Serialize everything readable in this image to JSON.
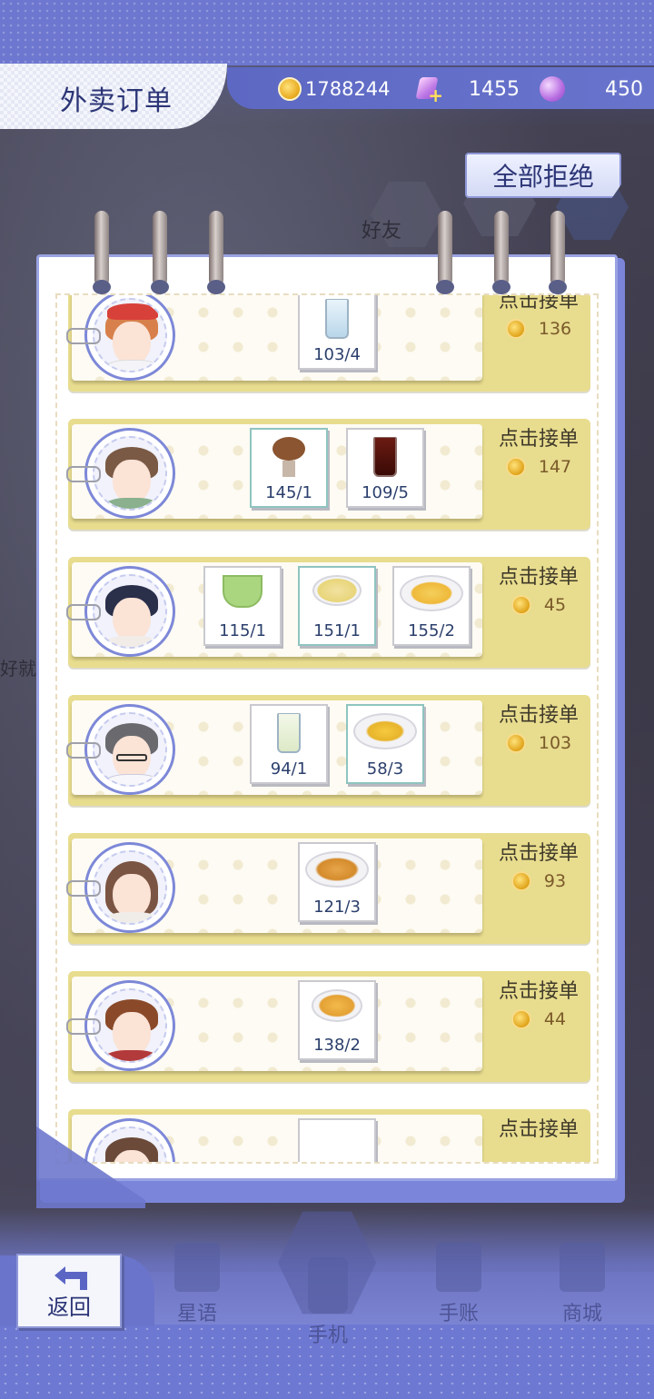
{
  "header": {
    "title": "外卖订单",
    "gold": "1788244",
    "diamonds": "1455",
    "stars": "450",
    "reject_all_label": "全部拒绝"
  },
  "background": {
    "friends_label": "好友",
    "left_text": "好就"
  },
  "orders": [
    {
      "accept_label": "点击接单",
      "reward": "136",
      "items": [
        {
          "name": "ice water",
          "count": "103/4"
        }
      ]
    },
    {
      "accept_label": "点击接单",
      "reward": "147",
      "items": [
        {
          "name": "chocolate sundae",
          "count": "145/1"
        },
        {
          "name": "cola",
          "count": "109/5"
        }
      ]
    },
    {
      "accept_label": "点击接单",
      "reward": "45",
      "items": [
        {
          "name": "green tea",
          "count": "115/1"
        },
        {
          "name": "corn soup",
          "count": "151/1"
        },
        {
          "name": "fruit plate",
          "count": "155/2"
        }
      ]
    },
    {
      "accept_label": "点击接单",
      "reward": "103",
      "items": [
        {
          "name": "milk",
          "count": "94/1"
        },
        {
          "name": "cake",
          "count": "58/3"
        }
      ]
    },
    {
      "accept_label": "点击接单",
      "reward": "93",
      "items": [
        {
          "name": "fried fish",
          "count": "121/3"
        }
      ]
    },
    {
      "accept_label": "点击接单",
      "reward": "44",
      "items": [
        {
          "name": "pancakes",
          "count": "138/2"
        }
      ]
    },
    {
      "accept_label": "点击接单",
      "reward": "",
      "items": [
        {
          "name": "dish",
          "count": ""
        }
      ]
    }
  ],
  "bottom_nav": {
    "back_label": "返回",
    "items": [
      "星语",
      "手机",
      "手账",
      "商城"
    ]
  },
  "colors": {
    "accent": "#6d77cf",
    "order_band": "#e8dc8e",
    "title_text": "#2c3576"
  }
}
